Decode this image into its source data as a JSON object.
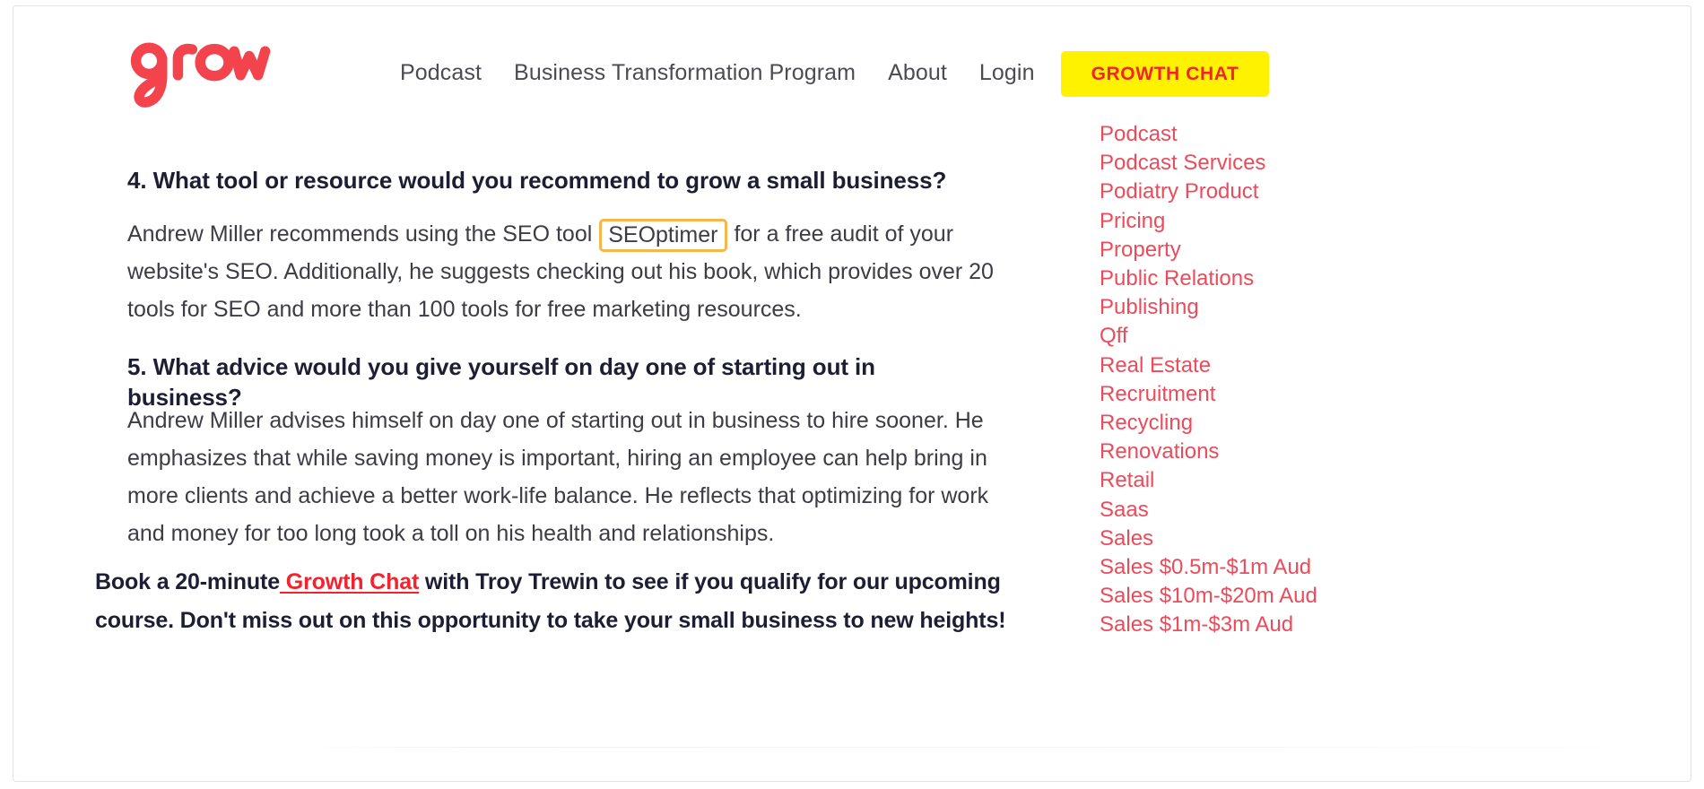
{
  "brand": {
    "logo_text": "grow",
    "logo_color": "#F3434C",
    "accent_red": "#F3232E",
    "accent_yellow": "#FFF200",
    "sidebar_link_color": "#EB4B5B",
    "highlight_border_color": "#F7B54A",
    "heading_color": "#1d1e33",
    "body_color": "#3c3c44"
  },
  "header": {
    "nav": [
      {
        "label": "Podcast"
      },
      {
        "label": "Business Transformation Program"
      },
      {
        "label": "About"
      },
      {
        "label": "Login"
      }
    ],
    "cta_label": "GROWTH CHAT"
  },
  "article": {
    "q4": {
      "heading": "4. What tool or resource would you recommend to grow a small business?",
      "body_before": "Andrew Miller recommends using the SEO tool",
      "highlighted_term": "SEOptimer",
      "body_after": "for a free audit of your website's SEO. Additionally, he suggests checking out his book, which provides over 20 tools for SEO and more than 100 tools for free marketing resources."
    },
    "q5": {
      "heading": "5. What advice would you give yourself on day one of starting out in business?",
      "body": "Andrew Miller advises himself on day one of starting out in business to hire sooner. He emphasizes that while saving money is important, hiring an employee can help bring in more clients and achieve a better work-life balance. He reflects that optimizing for work and money for too long took a toll on his health and relationships."
    },
    "cta_paragraph": {
      "before_link": "Book a 20-minute",
      "link_label": " Growth Chat",
      "after_link": " with Troy Trewin to see if you qualify for our upcoming course. Don't miss out on this opportunity to take your small business to new heights!"
    }
  },
  "sidebar": {
    "categories": [
      {
        "label": "Podcast"
      },
      {
        "label": "Podcast Services"
      },
      {
        "label": "Podiatry Product"
      },
      {
        "label": "Pricing"
      },
      {
        "label": "Property"
      },
      {
        "label": "Public Relations"
      },
      {
        "label": "Publishing"
      },
      {
        "label": "Qff"
      },
      {
        "label": "Real Estate"
      },
      {
        "label": "Recruitment"
      },
      {
        "label": "Recycling"
      },
      {
        "label": "Renovations"
      },
      {
        "label": "Retail"
      },
      {
        "label": "Saas"
      },
      {
        "label": "Sales"
      },
      {
        "label": "Sales $0.5m-$1m Aud"
      },
      {
        "label": "Sales $10m-$20m Aud"
      },
      {
        "label": "Sales $1m-$3m Aud"
      }
    ]
  }
}
